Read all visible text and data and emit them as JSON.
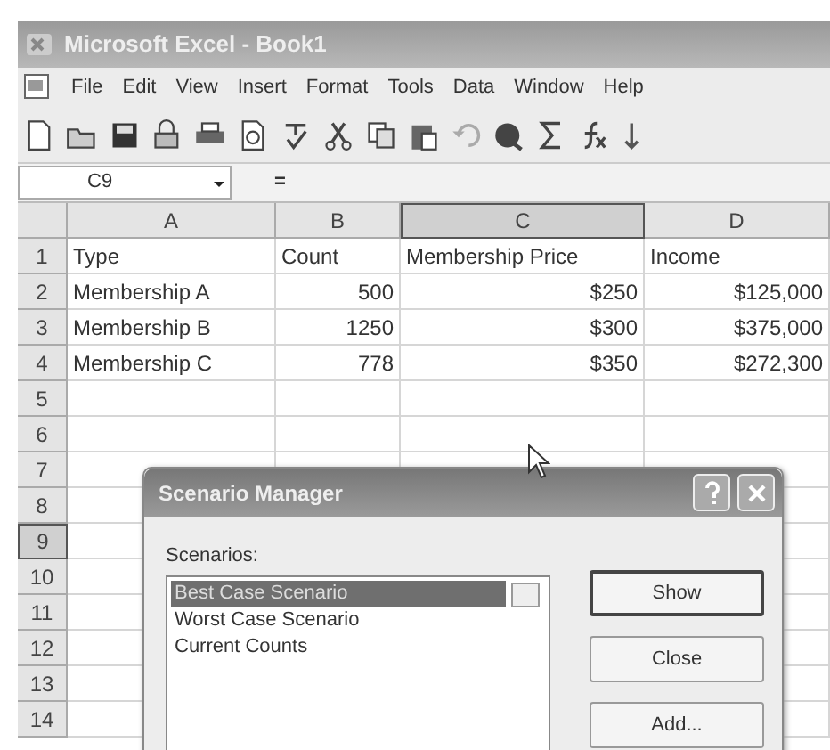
{
  "window": {
    "title": "Microsoft Excel - Book1"
  },
  "menu": [
    "File",
    "Edit",
    "View",
    "Insert",
    "Format",
    "Tools",
    "Data",
    "Window",
    "Help"
  ],
  "name_box": {
    "value": "C9",
    "formula_mark": "="
  },
  "columns": [
    {
      "label": "A",
      "selected": false
    },
    {
      "label": "B",
      "selected": false
    },
    {
      "label": "C",
      "selected": true
    },
    {
      "label": "D",
      "selected": false
    }
  ],
  "rows": [
    {
      "number": "1",
      "selected": false,
      "cells": [
        {
          "text": "Type",
          "kind": "text"
        },
        {
          "text": "Count",
          "kind": "text"
        },
        {
          "text": "Membership Price",
          "kind": "text"
        },
        {
          "text": "Income",
          "kind": "text"
        }
      ]
    },
    {
      "number": "2",
      "selected": false,
      "cells": [
        {
          "text": "Membership A",
          "kind": "text"
        },
        {
          "text": "500",
          "kind": "number"
        },
        {
          "text": "$250",
          "kind": "number"
        },
        {
          "text": "$125,000",
          "kind": "number"
        }
      ]
    },
    {
      "number": "3",
      "selected": false,
      "cells": [
        {
          "text": "Membership B",
          "kind": "text"
        },
        {
          "text": "1250",
          "kind": "number"
        },
        {
          "text": "$300",
          "kind": "number"
        },
        {
          "text": "$375,000",
          "kind": "number"
        }
      ]
    },
    {
      "number": "4",
      "selected": false,
      "cells": [
        {
          "text": "Membership C",
          "kind": "text"
        },
        {
          "text": "778",
          "kind": "number"
        },
        {
          "text": "$350",
          "kind": "number"
        },
        {
          "text": "$272,300",
          "kind": "number"
        }
      ]
    },
    {
      "number": "5",
      "selected": false,
      "cells": []
    },
    {
      "number": "6",
      "selected": false,
      "cells": []
    },
    {
      "number": "7",
      "selected": false,
      "cells": []
    },
    {
      "number": "8",
      "selected": false,
      "cells": []
    },
    {
      "number": "9",
      "selected": true,
      "cells": []
    },
    {
      "number": "10",
      "selected": false,
      "cells": []
    },
    {
      "number": "11",
      "selected": false,
      "cells": []
    },
    {
      "number": "12",
      "selected": false,
      "cells": []
    },
    {
      "number": "13",
      "selected": false,
      "cells": []
    },
    {
      "number": "14",
      "selected": false,
      "cells": []
    }
  ],
  "dialog": {
    "title": "Scenario Manager",
    "list_label": "Scenarios:",
    "scenarios": [
      {
        "label": "Best Case Scenario",
        "selected": true
      },
      {
        "label": "Worst Case Scenario",
        "selected": false
      },
      {
        "label": "Current Counts",
        "selected": false
      }
    ],
    "buttons": [
      {
        "label": "Show",
        "default": true
      },
      {
        "label": "Close",
        "default": false
      },
      {
        "label": "Add...",
        "default": false
      }
    ]
  }
}
